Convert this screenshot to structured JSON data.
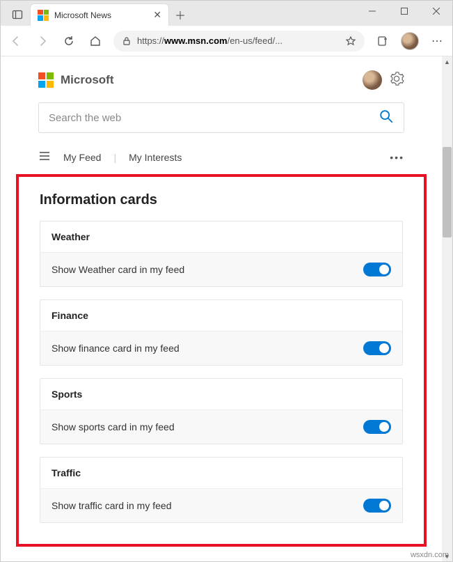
{
  "browser": {
    "tab_title": "Microsoft News",
    "url_host": "www.msn.com",
    "url_prefix": "https://",
    "url_path": "/en-us/feed/..."
  },
  "header": {
    "brand": "Microsoft"
  },
  "search": {
    "placeholder": "Search the web"
  },
  "nav": {
    "item1": "My Feed",
    "item2": "My Interests"
  },
  "section": {
    "title": "Information cards"
  },
  "cards": [
    {
      "title": "Weather",
      "label": "Show Weather card in my feed",
      "on": true
    },
    {
      "title": "Finance",
      "label": "Show finance card in my feed",
      "on": true
    },
    {
      "title": "Sports",
      "label": "Show sports card in my feed",
      "on": true
    },
    {
      "title": "Traffic",
      "label": "Show traffic card in my feed",
      "on": true
    }
  ],
  "watermark": "wsxdn.com"
}
